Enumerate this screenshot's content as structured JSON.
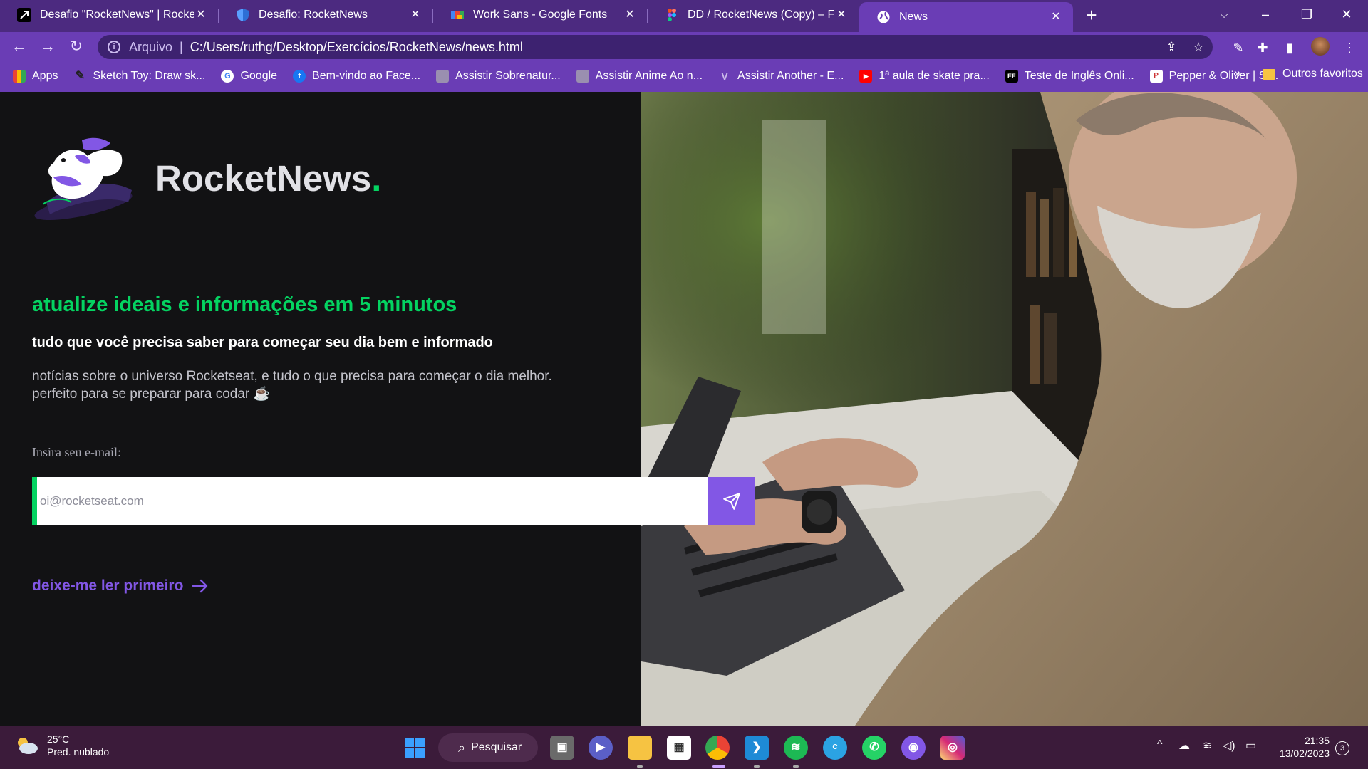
{
  "browser": {
    "tabs": [
      {
        "title": "Desafio \"RocketNews\" | Rocketseat",
        "icon": "rocketseat-icon"
      },
      {
        "title": "Desafio: RocketNews",
        "icon": "shield-icon"
      },
      {
        "title": "Work Sans - Google Fonts",
        "icon": "google-fonts-icon"
      },
      {
        "title": "DD / RocketNews (Copy) – Figma",
        "icon": "figma-icon"
      },
      {
        "title": "News",
        "icon": "globe-icon"
      }
    ],
    "address": {
      "scheme_label": "Arquivo",
      "path": "C:/Users/ruthg/Desktop/Exercícios/RocketNews/news.html"
    },
    "bookmarks": [
      {
        "label": "Apps",
        "icon": "apps-grid-icon"
      },
      {
        "label": "Sketch Toy: Draw sk...",
        "icon": "sketch-toy-icon"
      },
      {
        "label": "Google",
        "icon": "google-icon"
      },
      {
        "label": "Bem-vindo ao Face...",
        "icon": "facebook-icon"
      },
      {
        "label": "Assistir Sobrenatur...",
        "icon": "video-site-icon"
      },
      {
        "label": "Assistir Anime Ao n...",
        "icon": "video-site-icon"
      },
      {
        "label": "Assistir Another - E...",
        "icon": "anime-site-icon"
      },
      {
        "label": "1ª aula de skate pra...",
        "icon": "youtube-icon"
      },
      {
        "label": "Teste de Inglês Onli...",
        "icon": "ef-icon"
      },
      {
        "label": "Pepper & Oliver | Si...",
        "icon": "pepper-oliver-icon"
      }
    ],
    "bookmarks_more": "»",
    "other_bookmarks": "Outros favoritos"
  },
  "page": {
    "brand_name": "RocketNews",
    "brand_dot": ".",
    "headline": "atualize ideais e informações em 5 minutos",
    "subheadline": "tudo que você precisa saber para começar seu dia bem e informado",
    "description_line1": "notícias sobre o universo Rocketseat, e tudo o que precisa para começar o dia melhor.",
    "description_line2": "perfeito para se preparar para codar ☕",
    "email_label": "Insira seu e-mail:",
    "email_placeholder": "oi@rocketseat.com",
    "email_value": "",
    "read_first_link": "deixe-me ler primeiro"
  },
  "taskbar": {
    "weather_temp": "25°C",
    "weather_desc": "Pred. nublado",
    "search_label": "Pesquisar",
    "time": "21:35",
    "date": "13/02/2023",
    "notification_count": "3",
    "apps": [
      "task-view",
      "teams",
      "file-explorer",
      "microsoft-store",
      "chrome",
      "vscode",
      "spotify",
      "canva",
      "whatsapp",
      "github-desktop",
      "instagram"
    ]
  },
  "colors": {
    "tab_strip": "#4c2a80",
    "toolbar": "#6a3db5",
    "page_bg": "#121214",
    "accent_green": "#04d361",
    "accent_purple": "#8257e5",
    "taskbar": "#3b1b3a"
  }
}
